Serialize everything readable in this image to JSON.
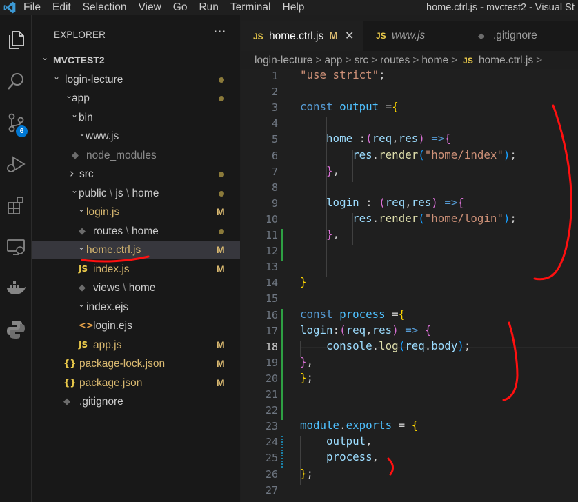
{
  "menu": {
    "items": [
      "File",
      "Edit",
      "Selection",
      "View",
      "Go",
      "Run",
      "Terminal",
      "Help"
    ],
    "window_title": "home.ctrl.js - mvctest2 - Visual St"
  },
  "activity_bar": {
    "items": [
      "explorer-icon",
      "search-icon",
      "source-control-icon",
      "run-debug-icon",
      "extensions-icon",
      "remote-explorer-icon",
      "docker-icon",
      "python-icon"
    ],
    "scm_badge": "6"
  },
  "explorer": {
    "header": "EXPLORER",
    "more": "···",
    "root": "MVCTEST2",
    "items": [
      {
        "name": "login-lecture",
        "icon": "chevron",
        "status": "dot"
      },
      {
        "name": "app",
        "icon": "chevron",
        "status": "dot"
      },
      {
        "name": "bin",
        "icon": "chevron"
      },
      {
        "name": "www.js",
        "icon": "JS"
      },
      {
        "name": "node_modules",
        "icon": "chevron-right"
      },
      {
        "name": "src",
        "icon": "chevron",
        "status": "dot"
      },
      {
        "name_parts": [
          "public",
          "js",
          "home"
        ],
        "icon": "chevron",
        "status": "dot"
      },
      {
        "name": "login.js",
        "icon": "JS",
        "status": "M"
      },
      {
        "name_parts": [
          "routes",
          "home"
        ],
        "icon": "chevron",
        "status": "dot"
      },
      {
        "name": "home.ctrl.js",
        "icon": "JS",
        "status": "M"
      },
      {
        "name": "index.js",
        "icon": "JS",
        "status": "M"
      },
      {
        "name_parts": [
          "views",
          "home"
        ],
        "icon": "chevron"
      },
      {
        "name": "index.ejs",
        "icon": "<>"
      },
      {
        "name": "login.ejs",
        "icon": "<>"
      },
      {
        "name": "app.js",
        "icon": "JS",
        "status": "M"
      },
      {
        "name": "package-lock.json",
        "icon": "{}",
        "status": "M"
      },
      {
        "name": "package.json",
        "icon": "{}",
        "status": "M"
      },
      {
        "name": ".gitignore",
        "icon": "git"
      }
    ],
    "path_separator": "\\",
    "file_icon_js": "JS",
    "file_icon_json": "{}",
    "file_icon_ejs": "<>",
    "chevron_down": "⌄",
    "chevron_right": "›",
    "modified_letter": "M"
  },
  "tabs": [
    {
      "icon": "JS",
      "label": "home.ctrl.js",
      "status": "M",
      "close": "✕",
      "active": true
    },
    {
      "icon": "JS",
      "label": "www.js",
      "active": false
    },
    {
      "icon": "git",
      "label": ".gitignore",
      "active": false
    }
  ],
  "breadcrumb": {
    "parts": [
      "login-lecture",
      "app",
      "src",
      "routes",
      "home"
    ],
    "file_icon": "JS",
    "file": "home.ctrl.js",
    "separator": ">"
  },
  "editor": {
    "line_numbers": [
      "1",
      "2",
      "3",
      "4",
      "5",
      "6",
      "7",
      "8",
      "9",
      "10",
      "11",
      "12",
      "13",
      "14",
      "15",
      "16",
      "17",
      "18",
      "19",
      "20",
      "21",
      "22",
      "23",
      "24",
      "25",
      "26",
      "27"
    ],
    "current_line": "18",
    "lines": [
      [
        [
          "s",
          "\"use strict\""
        ],
        [
          "t",
          ";"
        ]
      ],
      [],
      [
        [
          "k",
          "const "
        ],
        [
          "v",
          "output"
        ],
        [
          "t",
          " ="
        ],
        [
          "b1",
          "{"
        ]
      ],
      [],
      [
        [
          "t",
          "    "
        ],
        [
          "p",
          "home"
        ],
        [
          "t",
          " :"
        ],
        [
          "b2",
          "("
        ],
        [
          "p",
          "req"
        ],
        [
          "t",
          ","
        ],
        [
          "p",
          "res"
        ],
        [
          "b2",
          ")"
        ],
        [
          "t",
          " "
        ],
        [
          "k",
          "=>"
        ],
        [
          "b2",
          "{"
        ]
      ],
      [
        [
          "t",
          "        "
        ],
        [
          "p",
          "res"
        ],
        [
          "t",
          "."
        ],
        [
          "f",
          "render"
        ],
        [
          "b3",
          "("
        ],
        [
          "s",
          "\"home/index\""
        ],
        [
          "b3",
          ")"
        ],
        [
          "t",
          ";"
        ]
      ],
      [
        [
          "t",
          "    "
        ],
        [
          "b2",
          "}"
        ],
        [
          "t",
          ","
        ]
      ],
      [],
      [
        [
          "t",
          "    "
        ],
        [
          "p",
          "login"
        ],
        [
          "t",
          " : "
        ],
        [
          "b2",
          "("
        ],
        [
          "p",
          "req"
        ],
        [
          "t",
          ","
        ],
        [
          "p",
          "res"
        ],
        [
          "b2",
          ")"
        ],
        [
          "t",
          " "
        ],
        [
          "k",
          "=>"
        ],
        [
          "b2",
          "{"
        ]
      ],
      [
        [
          "t",
          "        "
        ],
        [
          "p",
          "res"
        ],
        [
          "t",
          "."
        ],
        [
          "f",
          "render"
        ],
        [
          "b3",
          "("
        ],
        [
          "s",
          "\"home/login\""
        ],
        [
          "b3",
          ")"
        ],
        [
          "t",
          ";"
        ]
      ],
      [
        [
          "t",
          "    "
        ],
        [
          "b2",
          "}"
        ],
        [
          "t",
          ","
        ]
      ],
      [],
      [],
      [
        [
          "b1",
          "}"
        ]
      ],
      [],
      [
        [
          "k",
          "const "
        ],
        [
          "v",
          "process"
        ],
        [
          "t",
          " ="
        ],
        [
          "b1",
          "{"
        ]
      ],
      [
        [
          "p",
          "login"
        ],
        [
          "t",
          ":"
        ],
        [
          "b2",
          "("
        ],
        [
          "p",
          "req"
        ],
        [
          "t",
          ","
        ],
        [
          "p",
          "res"
        ],
        [
          "b2",
          ")"
        ],
        [
          "t",
          " "
        ],
        [
          "k",
          "=>"
        ],
        [
          "t",
          " "
        ],
        [
          "b2",
          "{"
        ]
      ],
      [
        [
          "t",
          "    "
        ],
        [
          "p",
          "console"
        ],
        [
          "t",
          "."
        ],
        [
          "f",
          "log"
        ],
        [
          "b3",
          "("
        ],
        [
          "p",
          "req"
        ],
        [
          "t",
          "."
        ],
        [
          "p",
          "body"
        ],
        [
          "b3",
          ")"
        ],
        [
          "t",
          ";"
        ]
      ],
      [
        [
          "b2",
          "}"
        ],
        [
          "t",
          ","
        ]
      ],
      [
        [
          "b1",
          "}"
        ],
        [
          "t",
          ";"
        ]
      ],
      [],
      [],
      [
        [
          "v",
          "module"
        ],
        [
          "t",
          "."
        ],
        [
          "v",
          "exports"
        ],
        [
          "t",
          " = "
        ],
        [
          "b1",
          "{"
        ]
      ],
      [
        [
          "t",
          "    "
        ],
        [
          "p",
          "output"
        ],
        [
          "t",
          ","
        ]
      ],
      [
        [
          "t",
          "    "
        ],
        [
          "p",
          "process"
        ],
        [
          "t",
          ","
        ]
      ],
      [
        [
          "b1",
          "}"
        ],
        [
          "t",
          ";"
        ]
      ],
      []
    ]
  },
  "colors": {
    "accent": "#0078d4",
    "annotation": "#ff1010",
    "diff_added": "#2ea043",
    "diff_modified": "#1b81a8"
  }
}
